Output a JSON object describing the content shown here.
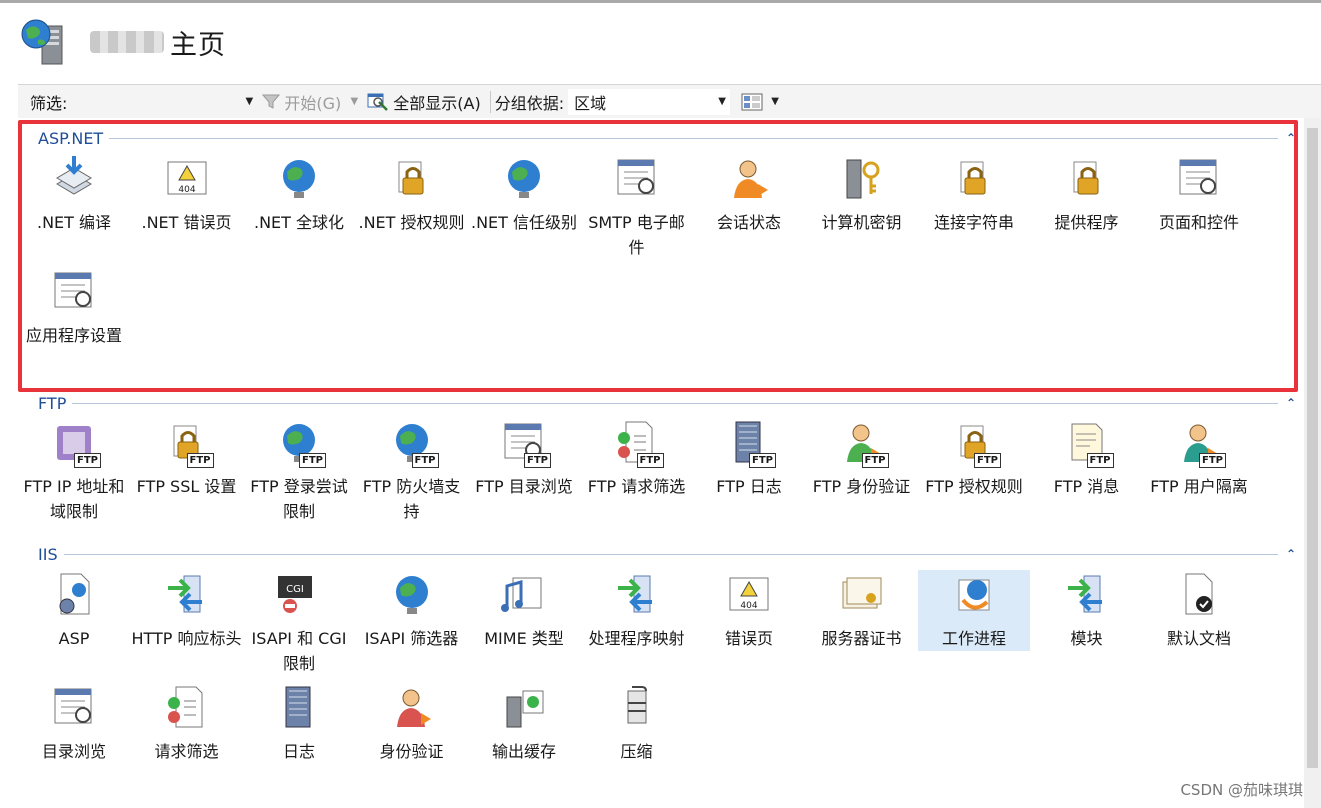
{
  "header": {
    "title": "主页"
  },
  "toolbar": {
    "filter_label": "筛选:",
    "start_label": "开始(G)",
    "show_all_label": "全部显示(A)",
    "group_by_label": "分组依据:",
    "group_by_value": "区域"
  },
  "sections": [
    {
      "name": "ASP.NET",
      "items": [
        {
          "label": ".NET 编译",
          "icon": "net-compile-icon"
        },
        {
          "label": ".NET 错误页",
          "icon": "net-error-pages-icon"
        },
        {
          "label": ".NET 全球化",
          "icon": "globe-icon"
        },
        {
          "label": ".NET 授权规则",
          "icon": "lock-document-icon"
        },
        {
          "label": ".NET 信任级别",
          "icon": "trust-level-icon"
        },
        {
          "label": "SMTP 电子邮件",
          "icon": "smtp-email-icon"
        },
        {
          "label": "会话状态",
          "icon": "session-state-icon"
        },
        {
          "label": "计算机密钥",
          "icon": "machine-key-icon"
        },
        {
          "label": "连接字符串",
          "icon": "connection-string-icon"
        },
        {
          "label": "提供程序",
          "icon": "providers-icon"
        },
        {
          "label": "页面和控件",
          "icon": "pages-controls-icon"
        },
        {
          "label": "应用程序设置",
          "icon": "app-settings-icon"
        }
      ]
    },
    {
      "name": "FTP",
      "items": [
        {
          "label": "FTP IP 地址和域限制",
          "icon": "ftp-ip-restrictions-icon"
        },
        {
          "label": "FTP SSL 设置",
          "icon": "ftp-ssl-icon"
        },
        {
          "label": "FTP 登录尝试限制",
          "icon": "ftp-logon-attempt-icon"
        },
        {
          "label": "FTP 防火墙支持",
          "icon": "ftp-firewall-icon"
        },
        {
          "label": "FTP 目录浏览",
          "icon": "ftp-directory-browsing-icon"
        },
        {
          "label": "FTP 请求筛选",
          "icon": "ftp-request-filtering-icon"
        },
        {
          "label": "FTP 日志",
          "icon": "ftp-logging-icon"
        },
        {
          "label": "FTP 身份验证",
          "icon": "ftp-authentication-icon"
        },
        {
          "label": "FTP 授权规则",
          "icon": "ftp-authorization-icon"
        },
        {
          "label": "FTP 消息",
          "icon": "ftp-messages-icon"
        },
        {
          "label": "FTP 用户隔离",
          "icon": "ftp-user-isolation-icon"
        }
      ]
    },
    {
      "name": "IIS",
      "items": [
        {
          "label": "ASP",
          "icon": "asp-icon"
        },
        {
          "label": "HTTP 响应标头",
          "icon": "http-headers-icon"
        },
        {
          "label": "ISAPI 和 CGI 限制",
          "icon": "isapi-cgi-icon"
        },
        {
          "label": "ISAPI 筛选器",
          "icon": "isapi-filter-icon"
        },
        {
          "label": "MIME 类型",
          "icon": "mime-types-icon"
        },
        {
          "label": "处理程序映射",
          "icon": "handler-mappings-icon"
        },
        {
          "label": "错误页",
          "icon": "error-pages-icon"
        },
        {
          "label": "服务器证书",
          "icon": "server-certificates-icon"
        },
        {
          "label": "工作进程",
          "icon": "worker-processes-icon"
        },
        {
          "label": "模块",
          "icon": "modules-icon"
        },
        {
          "label": "默认文档",
          "icon": "default-document-icon"
        },
        {
          "label": "目录浏览",
          "icon": "directory-browsing-icon"
        },
        {
          "label": "请求筛选",
          "icon": "request-filtering-icon"
        },
        {
          "label": "日志",
          "icon": "logging-icon"
        },
        {
          "label": "身份验证",
          "icon": "authentication-icon"
        },
        {
          "label": "输出缓存",
          "icon": "output-caching-icon"
        },
        {
          "label": "压缩",
          "icon": "compression-icon"
        }
      ]
    }
  ],
  "watermark": "CSDN @茄味琪琪"
}
